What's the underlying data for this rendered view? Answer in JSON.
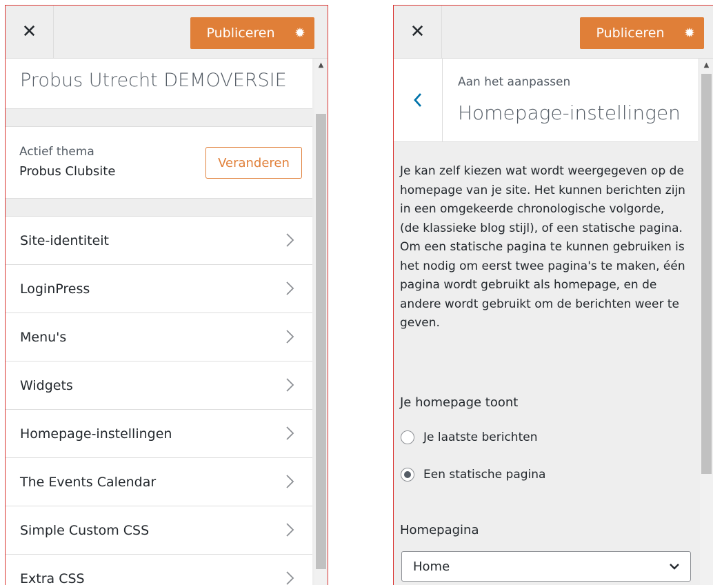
{
  "left_panel": {
    "publish_label": "Publiceren",
    "site_title": "Probus Utrecht DEMOVERSIE",
    "theme": {
      "label": "Actief thema",
      "name": "Probus Clubsite",
      "change_label": "Veranderen"
    },
    "items": [
      {
        "label": "Site-identiteit"
      },
      {
        "label": "LoginPress"
      },
      {
        "label": "Menu's"
      },
      {
        "label": "Widgets"
      },
      {
        "label": "Homepage-instellingen"
      },
      {
        "label": "The Events Calendar"
      },
      {
        "label": "Simple Custom CSS"
      },
      {
        "label": "Extra CSS"
      }
    ]
  },
  "right_panel": {
    "publish_label": "Publiceren",
    "customizing_label": "Aan het aanpassen",
    "section_title": "Homepage-instellingen",
    "description": "Je kan zelf kiezen wat wordt weergegeven op de homepage van je site. Het kunnen berichten zijn in een omgekeerde chronologische volgorde, (de klassieke blog stijl), of een statische pagina. Om een statische pagina te kunnen gebruiken is het nodig om eerst twee pagina's te maken, één pagina wordt gebruikt als homepage, en de andere wordt gebruikt om de berichten weer te geven.",
    "homepage_shows_label": "Je homepage toont",
    "options": [
      {
        "label": "Je laatste berichten",
        "checked": false
      },
      {
        "label": "Een statische pagina",
        "checked": true
      }
    ],
    "homepage_label": "Homepagina",
    "homepage_value": "Home"
  },
  "colors": {
    "accent": "#e07f38",
    "frame_border": "#d9302c",
    "back_arrow": "#0073aa"
  },
  "icons": {
    "close": "close-icon",
    "settings": "gear-icon",
    "item_arrow": "chevron-right-icon",
    "back": "chevron-left-icon",
    "dropdown": "chevron-down-icon"
  }
}
